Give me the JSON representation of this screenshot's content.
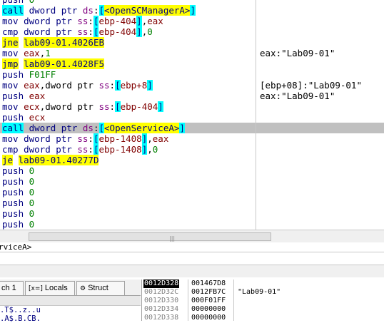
{
  "disasm": [
    {
      "parts": [
        [
          "kw",
          "push "
        ],
        [
          "num",
          "0"
        ]
      ]
    },
    {
      "parts": [
        [
          "hl-c",
          "call"
        ],
        [
          "kw",
          " dword ptr "
        ],
        [
          "seg",
          "ds"
        ],
        [
          "",
          ":"
        ],
        [
          "hl-c",
          "["
        ],
        [
          "hl-y",
          "<OpenSCManagerA>"
        ],
        [
          "hl-c",
          "]"
        ]
      ]
    },
    {
      "parts": [
        [
          "kw",
          "mov dword ptr "
        ],
        [
          "seg",
          "ss"
        ],
        [
          "",
          ":"
        ],
        [
          "hl-c",
          "["
        ],
        [
          "reg",
          "ebp-404"
        ],
        [
          "hl-c",
          "]"
        ],
        [
          "",
          ","
        ],
        [
          "reg",
          "eax"
        ]
      ]
    },
    {
      "parts": [
        [
          "kw",
          "cmp dword ptr "
        ],
        [
          "seg",
          "ss"
        ],
        [
          "",
          ":"
        ],
        [
          "hl-c",
          "["
        ],
        [
          "reg",
          "ebp-404"
        ],
        [
          "hl-c",
          "]"
        ],
        [
          "",
          ","
        ],
        [
          "num",
          "0"
        ]
      ]
    },
    {
      "parts": [
        [
          "hl-y",
          "jne"
        ],
        [
          "kw",
          " "
        ],
        [
          "hl-y",
          "lab09-01.4026EB"
        ]
      ]
    },
    {
      "parts": [
        [
          "kw",
          "mov "
        ],
        [
          "reg",
          "eax"
        ],
        [
          "",
          ","
        ],
        [
          "num",
          "1"
        ]
      ],
      "comment": "eax:\"Lab09-01\""
    },
    {
      "parts": [
        [
          "hl-y",
          "jmp"
        ],
        [
          "kw",
          " "
        ],
        [
          "hl-y",
          "lab09-01.4028F5"
        ]
      ]
    },
    {
      "parts": [
        [
          "kw",
          "push "
        ],
        [
          "num",
          "F01FF"
        ]
      ]
    },
    {
      "parts": [
        [
          "kw",
          "mov "
        ],
        [
          "reg",
          "eax"
        ],
        [
          "",
          ",dword ptr "
        ],
        [
          "seg",
          "ss"
        ],
        [
          "",
          ":"
        ],
        [
          "hl-c",
          "["
        ],
        [
          "reg",
          "ebp+8"
        ],
        [
          "hl-c",
          "]"
        ]
      ],
      "comment": "[ebp+08]:\"Lab09-01\""
    },
    {
      "parts": [
        [
          "kw",
          "push "
        ],
        [
          "reg",
          "eax"
        ]
      ],
      "comment": "eax:\"Lab09-01\""
    },
    {
      "parts": [
        [
          "kw",
          "mov "
        ],
        [
          "reg",
          "ecx"
        ],
        [
          "",
          ",dword ptr "
        ],
        [
          "seg",
          "ss"
        ],
        [
          "",
          ":"
        ],
        [
          "hl-c",
          "["
        ],
        [
          "reg",
          "ebp-404"
        ],
        [
          "hl-c",
          "]"
        ]
      ]
    },
    {
      "parts": [
        [
          "kw",
          "push "
        ],
        [
          "reg",
          "ecx"
        ]
      ]
    },
    {
      "parts": [
        [
          "hl-c",
          "call"
        ],
        [
          "kw",
          " dword ptr "
        ],
        [
          "seg",
          "ds"
        ],
        [
          "",
          ":"
        ],
        [
          "hl-c",
          "["
        ],
        [
          "hl-y",
          "<OpenServiceA>"
        ],
        [
          "hl-c",
          "]"
        ]
      ],
      "selected": true
    },
    {
      "parts": [
        [
          "kw",
          "mov dword ptr "
        ],
        [
          "seg",
          "ss"
        ],
        [
          "",
          ":"
        ],
        [
          "hl-c",
          "["
        ],
        [
          "reg",
          "ebp-1408"
        ],
        [
          "hl-c",
          "]"
        ],
        [
          "",
          ","
        ],
        [
          "reg",
          "eax"
        ]
      ]
    },
    {
      "parts": [
        [
          "kw",
          "cmp dword ptr "
        ],
        [
          "seg",
          "ss"
        ],
        [
          "",
          ":"
        ],
        [
          "hl-c",
          "["
        ],
        [
          "reg",
          "ebp-1408"
        ],
        [
          "hl-c",
          "]"
        ],
        [
          "",
          ","
        ],
        [
          "num",
          "0"
        ]
      ]
    },
    {
      "parts": [
        [
          "hl-y",
          "je"
        ],
        [
          "kw",
          " "
        ],
        [
          "hl-y",
          "lab09-01.40277D"
        ]
      ]
    },
    {
      "parts": [
        [
          "kw",
          "push "
        ],
        [
          "num",
          "0"
        ]
      ]
    },
    {
      "parts": [
        [
          "kw",
          "push "
        ],
        [
          "num",
          "0"
        ]
      ]
    },
    {
      "parts": [
        [
          "kw",
          "push "
        ],
        [
          "num",
          "0"
        ]
      ]
    },
    {
      "parts": [
        [
          "kw",
          "push "
        ],
        [
          "num",
          "0"
        ]
      ]
    },
    {
      "parts": [
        [
          "kw",
          "push "
        ],
        [
          "num",
          "0"
        ]
      ]
    },
    {
      "parts": [
        [
          "kw",
          "push "
        ],
        [
          "num",
          "0"
        ]
      ]
    }
  ],
  "info_line": "rviceA>",
  "tabs": [
    {
      "icon": "",
      "label": "ch 1"
    },
    {
      "icon": "[x=]",
      "label": "Locals"
    },
    {
      "icon": "⚙",
      "label": "Struct"
    }
  ],
  "dump_rows": [
    ".T$..z..u",
    ".A$.B.CB."
  ],
  "stack": [
    {
      "addr": "0012D328",
      "val": "001467D8",
      "cmt": "",
      "current": true
    },
    {
      "addr": "0012D32C",
      "val": "0012FB7C",
      "cmt": "\"Lab09-01\""
    },
    {
      "addr": "0012D330",
      "val": "000F01FF",
      "cmt": ""
    },
    {
      "addr": "0012D334",
      "val": "00000000",
      "cmt": ""
    },
    {
      "addr": "0012D338",
      "val": "00000000",
      "cmt": ""
    }
  ]
}
